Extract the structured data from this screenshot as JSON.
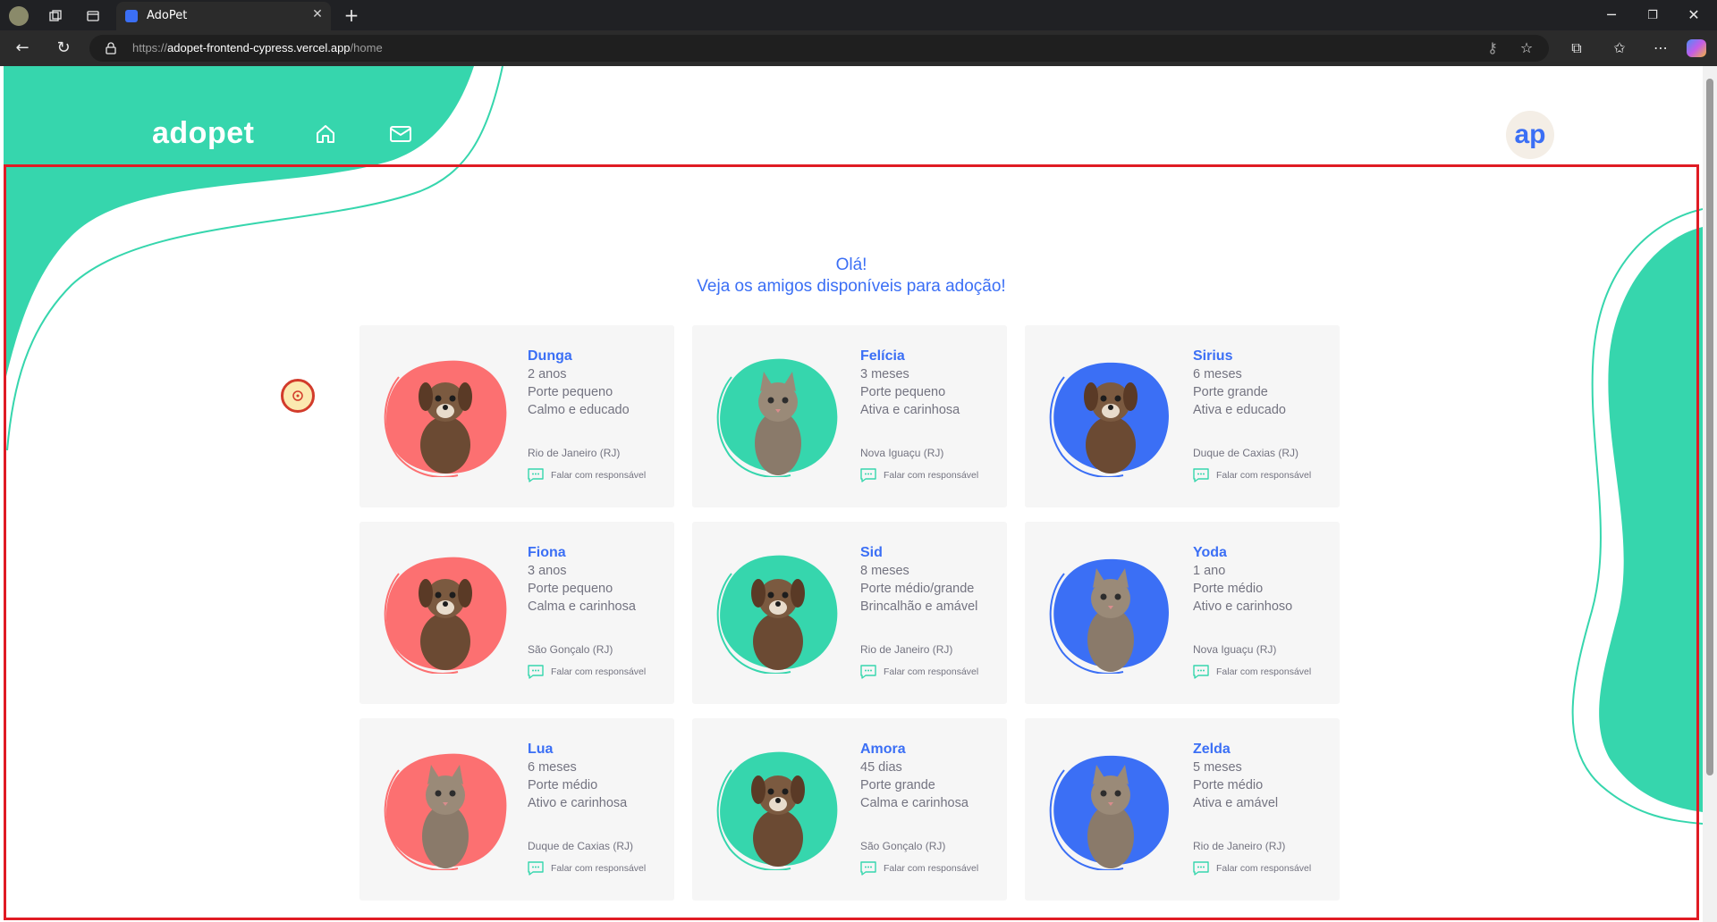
{
  "browser": {
    "tab_title": "AdoPet",
    "url_scheme": "https://",
    "url_host": "adopet-frontend-cypress.vercel.app",
    "url_path": "/home"
  },
  "header": {
    "logo_text": "adopet",
    "avatar_text": "ap",
    "colors": {
      "brand_green": "#36d6ad",
      "brand_blue": "#3b6ff5",
      "coral": "#fc7071"
    }
  },
  "main": {
    "greeting_line1": "Olá!",
    "greeting_line2": "Veja os amigos disponíveis para adoção!",
    "contact_label": "Falar com responsável",
    "pets": [
      {
        "name": "Dunga",
        "age": "2 anos",
        "size": "Porte pequeno",
        "temper": "Calmo e educado",
        "city": "Rio de Janeiro (RJ)",
        "color": "#fc7071",
        "animal": "dog"
      },
      {
        "name": "Felícia",
        "age": "3 meses",
        "size": "Porte pequeno",
        "temper": "Ativa e carinhosa",
        "city": "Nova Iguaçu (RJ)",
        "color": "#36d6ad",
        "animal": "cat"
      },
      {
        "name": "Sirius",
        "age": "6 meses",
        "size": "Porte grande",
        "temper": "Ativa e educado",
        "city": "Duque de Caxias (RJ)",
        "color": "#3b6ff5",
        "animal": "dog"
      },
      {
        "name": "Fiona",
        "age": "3 anos",
        "size": "Porte pequeno",
        "temper": "Calma e carinhosa",
        "city": "São Gonçalo (RJ)",
        "color": "#fc7071",
        "animal": "dog"
      },
      {
        "name": "Sid",
        "age": "8 meses",
        "size": "Porte médio/grande",
        "temper": "Brincalhão e amável",
        "city": "Rio de Janeiro (RJ)",
        "color": "#36d6ad",
        "animal": "dog"
      },
      {
        "name": "Yoda",
        "age": "1 ano",
        "size": "Porte médio",
        "temper": "Ativo e carinhoso",
        "city": "Nova Iguaçu (RJ)",
        "color": "#3b6ff5",
        "animal": "cat"
      },
      {
        "name": "Lua",
        "age": "6 meses",
        "size": "Porte médio",
        "temper": "Ativo e carinhosa",
        "city": "Duque de Caxias (RJ)",
        "color": "#fc7071",
        "animal": "cat"
      },
      {
        "name": "Amora",
        "age": "45 dias",
        "size": "Porte grande",
        "temper": "Calma e carinhosa",
        "city": "São Gonçalo (RJ)",
        "color": "#36d6ad",
        "animal": "dog"
      },
      {
        "name": "Zelda",
        "age": "5 meses",
        "size": "Porte médio",
        "temper": "Ativa e amável",
        "city": "Rio de Janeiro (RJ)",
        "color": "#3b6ff5",
        "animal": "cat"
      }
    ]
  }
}
